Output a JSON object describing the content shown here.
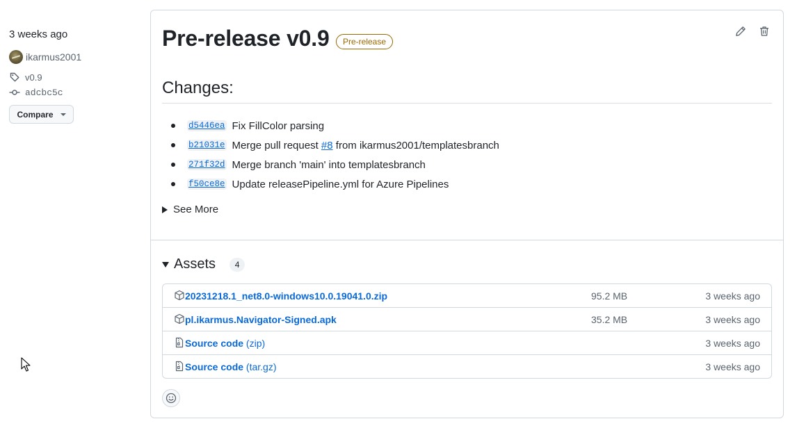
{
  "sidebar": {
    "time": "3 weeks ago",
    "author": "ikarmus2001",
    "tag": "v0.9",
    "commit": "adcbc5c",
    "compare_label": "Compare"
  },
  "release": {
    "title": "Pre-release v0.9",
    "badge": "Pre-release"
  },
  "changes": {
    "heading": "Changes:",
    "commits": [
      {
        "sha": "d5446ea",
        "before": "Fix FillColor parsing",
        "link": "",
        "after": ""
      },
      {
        "sha": "b21031e",
        "before": "Merge pull request ",
        "link": "#8",
        "after": " from ikarmus2001/templatesbranch"
      },
      {
        "sha": "271f32d",
        "before": "Merge branch 'main' into templatesbranch",
        "link": "",
        "after": ""
      },
      {
        "sha": "f50ce8e",
        "before": "Update releasePipeline.yml for Azure Pipelines",
        "link": "",
        "after": ""
      }
    ],
    "see_more": "See More"
  },
  "assets": {
    "title": "Assets",
    "count": "4",
    "items": [
      {
        "icon": "package-icon",
        "name": "20231218.1_net8.0-windows10.0.19041.0.zip",
        "suffix": "",
        "size": "95.2 MB",
        "time": "3 weeks ago"
      },
      {
        "icon": "package-icon",
        "name": "pl.ikarmus.Navigator-Signed.apk",
        "suffix": "",
        "size": "35.2 MB",
        "time": "3 weeks ago"
      },
      {
        "icon": "file-zip-icon",
        "name": "Source code",
        "suffix": " (zip)",
        "size": "",
        "time": "3 weeks ago"
      },
      {
        "icon": "file-zip-icon",
        "name": "Source code",
        "suffix": " (tar.gz)",
        "size": "",
        "time": "3 weeks ago"
      }
    ]
  },
  "colors": {
    "link": "#0969da",
    "prerelease": "#9a6700",
    "muted": "#59636e",
    "border": "#d1d9e0"
  }
}
